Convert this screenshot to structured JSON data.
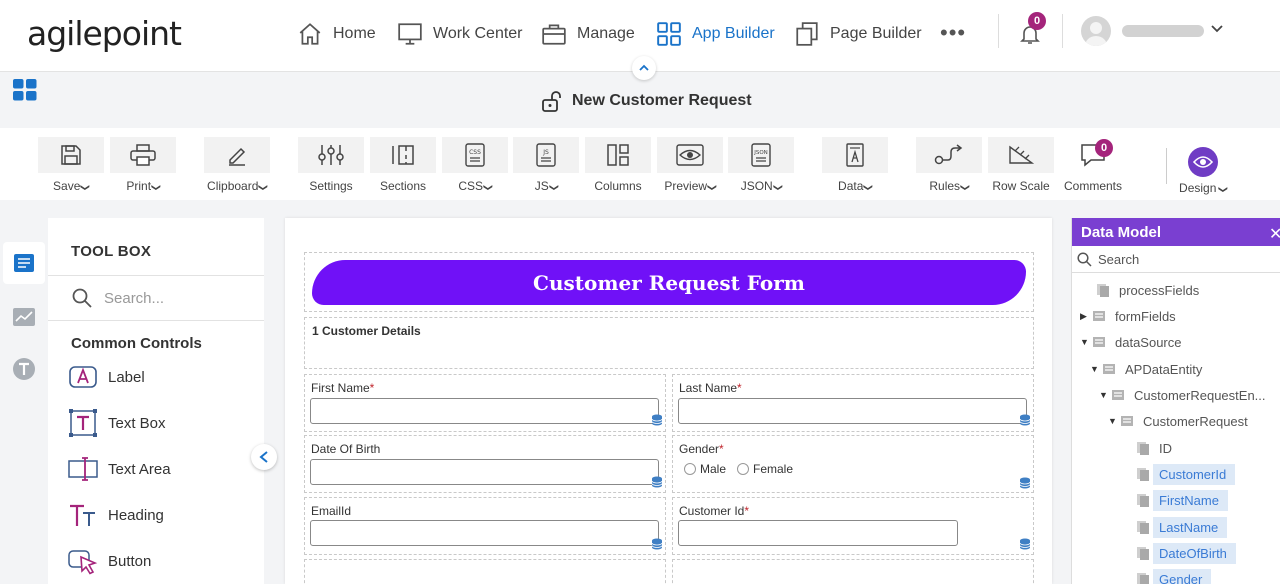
{
  "brand": {
    "logo_text": "agilepoint",
    "accent": "#1a73c9",
    "primary_purple": "#7011f7",
    "panel_purple": "#7a3fd1",
    "badge_color": "#a4247b"
  },
  "nav": {
    "items": [
      {
        "label": "Home",
        "icon": "home-icon"
      },
      {
        "label": "Work Center",
        "icon": "monitor-icon"
      },
      {
        "label": "Manage",
        "icon": "briefcase-icon"
      },
      {
        "label": "App Builder",
        "icon": "grid-icon",
        "active": true
      },
      {
        "label": "Page Builder",
        "icon": "copy-pages-icon"
      }
    ],
    "more": "•••",
    "notification_count": "0"
  },
  "form_title": "New Customer Request",
  "toolbar": {
    "items": [
      {
        "label": "Save",
        "dropdown": true
      },
      {
        "label": "Print",
        "dropdown": true
      },
      {
        "label": "Clipboard",
        "dropdown": true
      },
      {
        "label": "Settings",
        "dropdown": false
      },
      {
        "label": "Sections",
        "dropdown": false
      },
      {
        "label": "CSS",
        "dropdown": true
      },
      {
        "label": "JS",
        "dropdown": true
      },
      {
        "label": "Columns",
        "dropdown": false
      },
      {
        "label": "Preview",
        "dropdown": true
      },
      {
        "label": "JSON",
        "dropdown": true
      },
      {
        "label": "Data",
        "dropdown": true
      },
      {
        "label": "Rules",
        "dropdown": true
      },
      {
        "label": "Row Scale",
        "dropdown": false
      },
      {
        "label": "Comments",
        "dropdown": false
      }
    ],
    "comments_count": "0",
    "design_label": "Design"
  },
  "toolbox": {
    "title": "TOOL BOX",
    "search_placeholder": "Search...",
    "section_title": "Common Controls",
    "controls": [
      "Label",
      "Text Box",
      "Text Area",
      "Heading",
      "Button"
    ]
  },
  "form": {
    "header": "Customer Request Form",
    "section": "1 Customer Details",
    "fields": {
      "first_name": {
        "label": "First Name",
        "required": "*"
      },
      "last_name": {
        "label": "Last Name",
        "required": "*"
      },
      "dob": {
        "label": "Date Of Birth"
      },
      "gender": {
        "label": "Gender",
        "required": "*",
        "options": [
          "Male",
          "Female"
        ]
      },
      "email": {
        "label": "EmailId"
      },
      "customer_id": {
        "label": "Customer Id",
        "required": "*"
      }
    }
  },
  "data_model": {
    "title": "Data Model",
    "close": "✕",
    "search_placeholder": "Search",
    "nodes": [
      "processFields",
      "formFields",
      "dataSource",
      "APDataEntity",
      "CustomerRequestEn...",
      "CustomerRequest",
      "ID",
      "CustomerId",
      "FirstName",
      "LastName",
      "DateOfBirth",
      "Gender"
    ]
  }
}
